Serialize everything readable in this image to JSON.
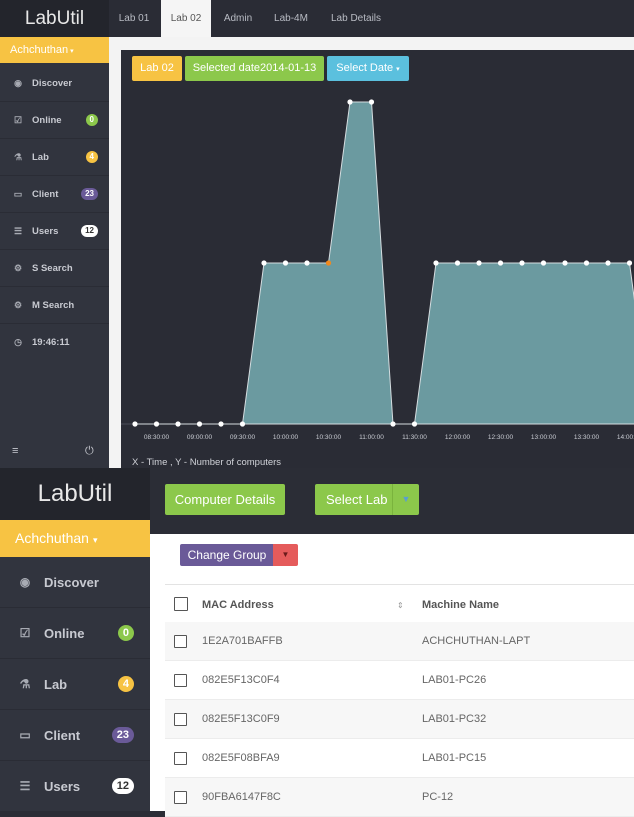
{
  "small": {
    "brand": "LabUtil",
    "tabs": [
      "Lab 01",
      "Lab 02",
      "Admin",
      "Lab-4M",
      "Lab Details"
    ],
    "active_tab": 1,
    "user": "Achchuthan",
    "nav": [
      {
        "icon": "eye-icon",
        "label": "Discover"
      },
      {
        "icon": "check-square-icon",
        "label": "Online",
        "badge": "0",
        "badge_color": "#8cc84b"
      },
      {
        "icon": "flask-icon",
        "label": "Lab",
        "badge": "4",
        "badge_color": "#f7c343"
      },
      {
        "icon": "laptop-icon",
        "label": "Client",
        "badge": "23",
        "badge_color": "#6a5a98"
      },
      {
        "icon": "list-icon",
        "label": "Users",
        "badge": "12",
        "badge_color": "#ffffff"
      },
      {
        "icon": "gears-icon",
        "label": "S Search"
      },
      {
        "icon": "gears-icon",
        "label": "M Search"
      },
      {
        "icon": "clock-icon",
        "label": "19:46:11"
      }
    ],
    "buttons": {
      "lab": "Lab 02",
      "selected_date": "Selected date2014-01-13",
      "select_date": "Select Date"
    },
    "axis_note": "X - Time , Y - Number of computers"
  },
  "chart_data": {
    "type": "area",
    "title": "",
    "xlabel": "X - Time",
    "ylabel": "Y - Number of computers",
    "x": [
      "08:20",
      "08:30",
      "08:45",
      "09:00",
      "09:15",
      "09:30",
      "09:45",
      "10:00",
      "10:15",
      "10:30",
      "10:45",
      "11:00",
      "11:15",
      "11:30",
      "11:45",
      "12:00",
      "12:15",
      "12:30",
      "12:45",
      "13:00",
      "13:15",
      "13:30",
      "13:45",
      "14:00",
      "14:15"
    ],
    "xticks": [
      "08:30:00",
      "09:00:00",
      "09:30:00",
      "10:00:00",
      "10:30:00",
      "11:00:00",
      "11:30:00",
      "12:00:00",
      "12:30:00",
      "13:00:00",
      "13:30:00",
      "14:00:00"
    ],
    "values": [
      0,
      0,
      0,
      0,
      0,
      0,
      1,
      1,
      1,
      1,
      2,
      2,
      0,
      0,
      1,
      1,
      1,
      1,
      1,
      1,
      1,
      1,
      1,
      1,
      0
    ],
    "highlight_index": 9,
    "colors": {
      "fill": "#6b9aa0",
      "line": "#d5dde0",
      "marker": "#ffffff",
      "highlight": "#f0891e"
    }
  },
  "large": {
    "brand": "LabUtil",
    "user": "Achchuthan",
    "nav": [
      {
        "icon": "eye-icon",
        "label": "Discover"
      },
      {
        "icon": "check-square-icon",
        "label": "Online",
        "badge": "0",
        "badge_color": "#8cc84b"
      },
      {
        "icon": "flask-icon",
        "label": "Lab",
        "badge": "4",
        "badge_color": "#f7c343"
      },
      {
        "icon": "laptop-icon",
        "label": "Client",
        "badge": "23",
        "badge_color": "#6a5a98"
      },
      {
        "icon": "list-icon",
        "label": "Users",
        "badge": "12",
        "badge_color": "#ffffff"
      }
    ],
    "buttons": {
      "computer_details": "Computer Details",
      "select_lab": "Select Lab",
      "change_group": "Change Group"
    },
    "table": {
      "columns": [
        "MAC Address",
        "Machine Name"
      ],
      "rows": [
        [
          "1E2A701BAFFB",
          "ACHCHUTHAN-LAPT"
        ],
        [
          "082E5F13C0F4",
          "LAB01-PC26"
        ],
        [
          "082E5F13C0F9",
          "LAB01-PC32"
        ],
        [
          "082E5F08BFA9",
          "LAB01-PC15"
        ],
        [
          "90FBA6147F8C",
          "PC-12"
        ]
      ]
    }
  }
}
